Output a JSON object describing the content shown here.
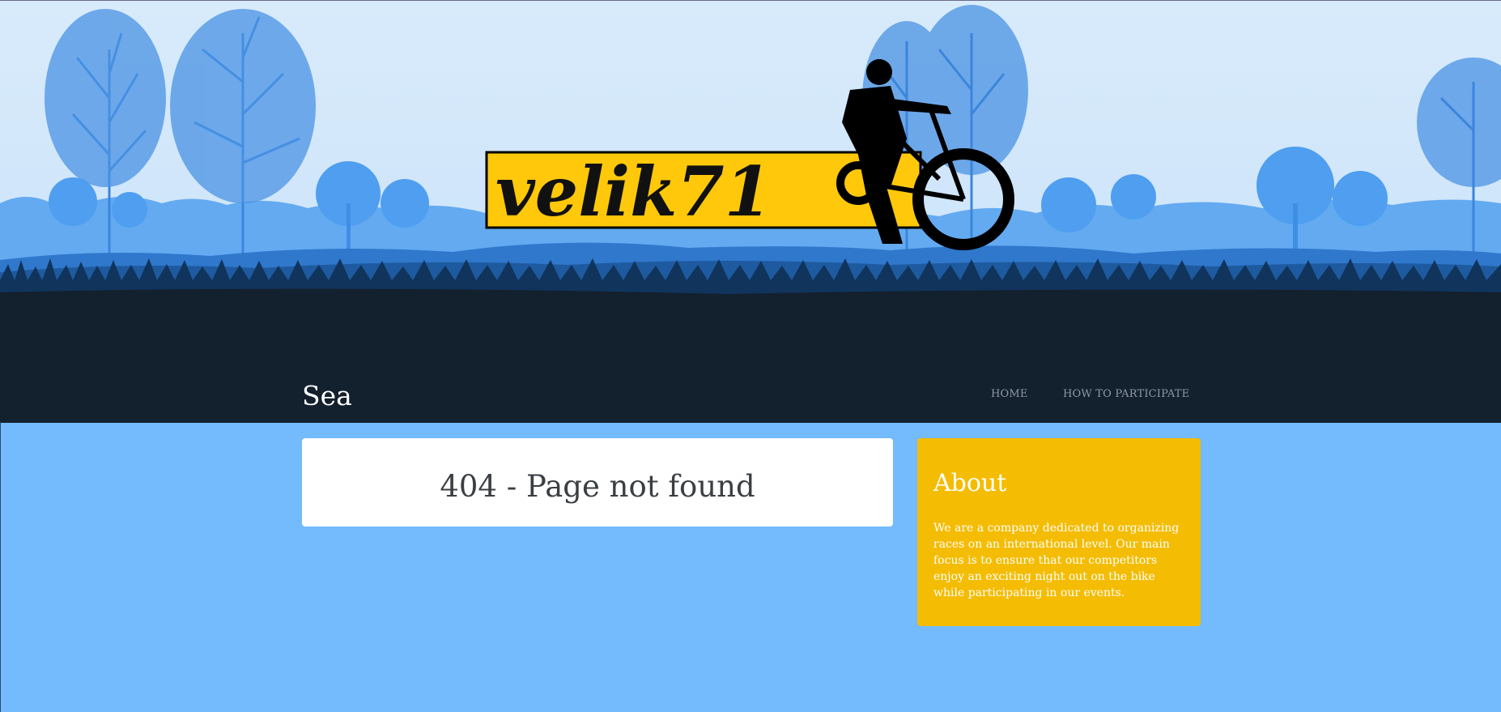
{
  "header": {
    "logo_text": "velik71",
    "site_title": "Sea"
  },
  "nav": {
    "items": [
      {
        "label": "HOME"
      },
      {
        "label": "HOW TO PARTICIPATE"
      }
    ]
  },
  "main": {
    "heading": "404 - Page not found"
  },
  "sidebar": {
    "about_title": "About",
    "about_text": "We are a company dedicated to organizing races on an international level. Our main focus is to ensure that our competitors enjoy an exciting night out on the bike while participating in our events."
  },
  "colors": {
    "page_background": "#73bbfc",
    "header_dark": "#13202e",
    "about_background": "#f4bc02",
    "logo_yellow": "#ffc80a"
  }
}
